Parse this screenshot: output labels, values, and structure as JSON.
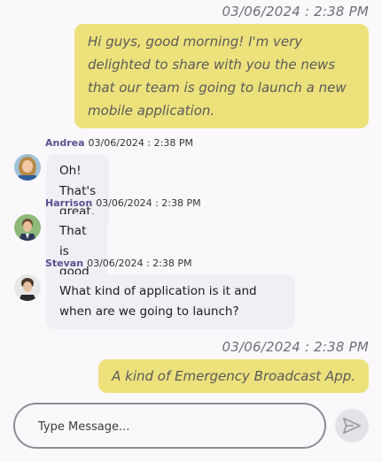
{
  "messages": {
    "m1": {
      "timestamp": "03/06/2024 : 2:38 PM",
      "text": "Hi guys, good morning! I'm very delighted to share with you the news that our team is going to launch a new mobile application."
    },
    "m2": {
      "sender": "Andrea",
      "timestamp": "03/06/2024 : 2:38 PM",
      "text": "Oh! That's great.",
      "avatar": "woman-avatar-icon"
    },
    "m3": {
      "sender": "Harrison",
      "timestamp": "03/06/2024 : 2:38 PM",
      "text": "That is good news.",
      "avatar": "man-avatar-icon"
    },
    "m4": {
      "sender": "Stevan",
      "timestamp": "03/06/2024 : 2:38 PM",
      "text": "What kind of application is it and when are we going to launch?",
      "avatar": "man-avatar-icon"
    },
    "m5": {
      "timestamp": "03/06/2024 : 2:38 PM",
      "text": "A kind of Emergency Broadcast App."
    }
  },
  "composer": {
    "placeholder": "Type Message..."
  },
  "send": {
    "icon": "send-icon"
  },
  "colors": {
    "outgoing_bubble": "#ede17c",
    "incoming_bubble": "#f2eef6",
    "sender_name": "#5a4f8f",
    "background": "#fbf8fc"
  }
}
